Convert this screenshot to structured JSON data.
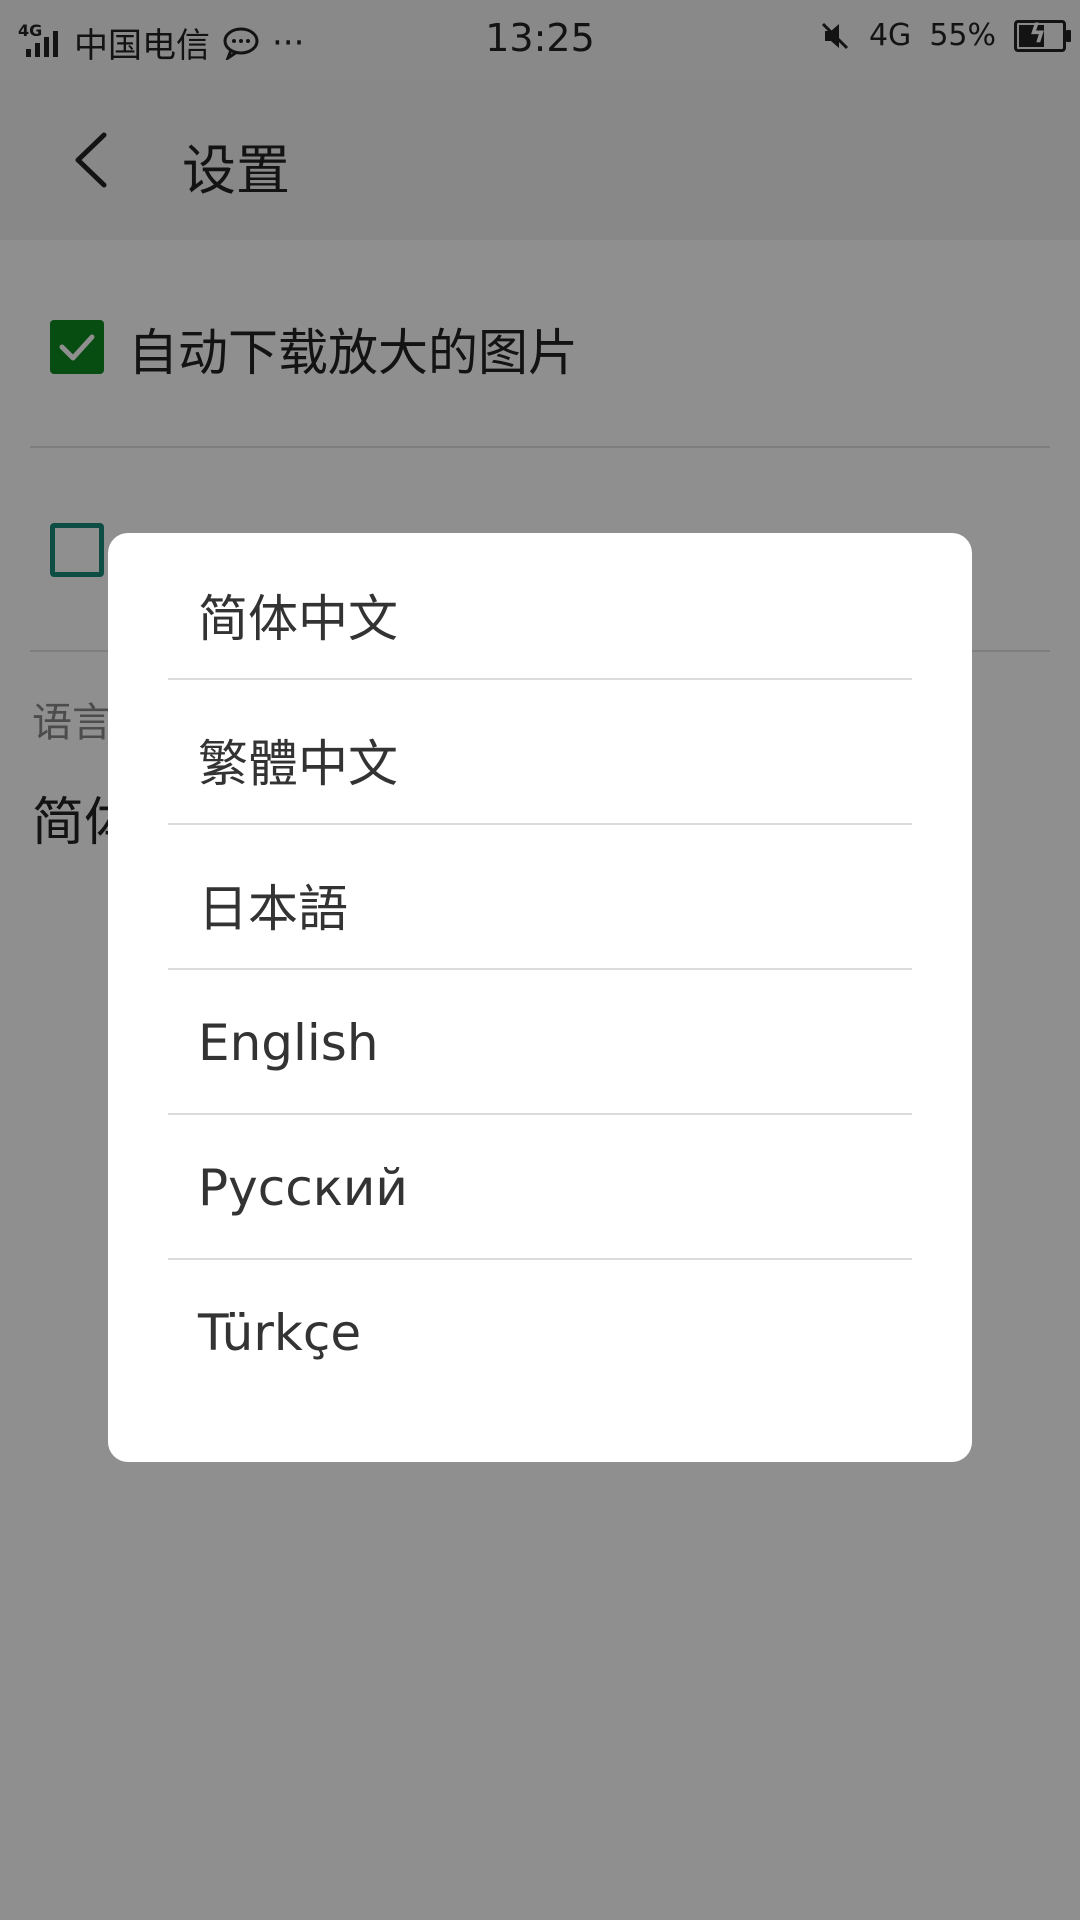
{
  "status_bar": {
    "network_tag": "4G",
    "carrier": "中国电信",
    "more_dots": "···",
    "time": "13:25",
    "mobile_data": "4G",
    "battery_percent": "55%",
    "icons": [
      "signal-icon",
      "chat-bubble-icon",
      "mute-icon",
      "battery-charging-icon"
    ]
  },
  "app_bar": {
    "title": "设置",
    "back_icon": "back-arrow-icon"
  },
  "settings": {
    "auto_download_label": "自动下载放大的图片",
    "auto_download_checked": true,
    "second_option_checked": false,
    "language_header": "语言",
    "language_value": "简体"
  },
  "language_dialog": {
    "options": [
      {
        "label": "简体中文"
      },
      {
        "label": "繁體中文"
      },
      {
        "label": "日本語"
      },
      {
        "label": "English"
      },
      {
        "label": "Русский"
      },
      {
        "label": "Türkçe"
      }
    ]
  },
  "colors": {
    "accent_checked": "#0d8a1f",
    "accent_unchecked_border": "#1a8a7a",
    "scrim": "rgba(0,0,0,0.44)"
  }
}
